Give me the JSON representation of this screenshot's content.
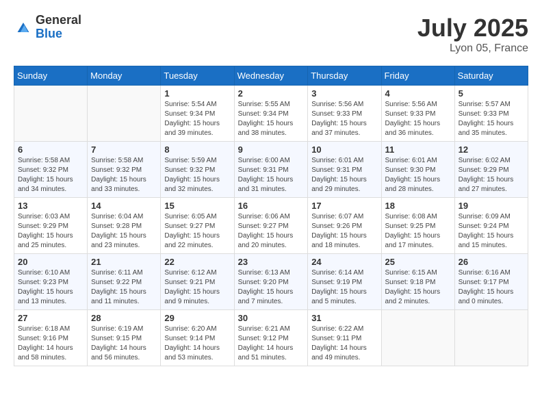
{
  "header": {
    "logo_general": "General",
    "logo_blue": "Blue",
    "month_year": "July 2025",
    "location": "Lyon 05, France"
  },
  "days_of_week": [
    "Sunday",
    "Monday",
    "Tuesday",
    "Wednesday",
    "Thursday",
    "Friday",
    "Saturday"
  ],
  "weeks": [
    [
      {
        "day": "",
        "info": ""
      },
      {
        "day": "",
        "info": ""
      },
      {
        "day": "1",
        "info": "Sunrise: 5:54 AM\nSunset: 9:34 PM\nDaylight: 15 hours and 39 minutes."
      },
      {
        "day": "2",
        "info": "Sunrise: 5:55 AM\nSunset: 9:34 PM\nDaylight: 15 hours and 38 minutes."
      },
      {
        "day": "3",
        "info": "Sunrise: 5:56 AM\nSunset: 9:33 PM\nDaylight: 15 hours and 37 minutes."
      },
      {
        "day": "4",
        "info": "Sunrise: 5:56 AM\nSunset: 9:33 PM\nDaylight: 15 hours and 36 minutes."
      },
      {
        "day": "5",
        "info": "Sunrise: 5:57 AM\nSunset: 9:33 PM\nDaylight: 15 hours and 35 minutes."
      }
    ],
    [
      {
        "day": "6",
        "info": "Sunrise: 5:58 AM\nSunset: 9:32 PM\nDaylight: 15 hours and 34 minutes."
      },
      {
        "day": "7",
        "info": "Sunrise: 5:58 AM\nSunset: 9:32 PM\nDaylight: 15 hours and 33 minutes."
      },
      {
        "day": "8",
        "info": "Sunrise: 5:59 AM\nSunset: 9:32 PM\nDaylight: 15 hours and 32 minutes."
      },
      {
        "day": "9",
        "info": "Sunrise: 6:00 AM\nSunset: 9:31 PM\nDaylight: 15 hours and 31 minutes."
      },
      {
        "day": "10",
        "info": "Sunrise: 6:01 AM\nSunset: 9:31 PM\nDaylight: 15 hours and 29 minutes."
      },
      {
        "day": "11",
        "info": "Sunrise: 6:01 AM\nSunset: 9:30 PM\nDaylight: 15 hours and 28 minutes."
      },
      {
        "day": "12",
        "info": "Sunrise: 6:02 AM\nSunset: 9:29 PM\nDaylight: 15 hours and 27 minutes."
      }
    ],
    [
      {
        "day": "13",
        "info": "Sunrise: 6:03 AM\nSunset: 9:29 PM\nDaylight: 15 hours and 25 minutes."
      },
      {
        "day": "14",
        "info": "Sunrise: 6:04 AM\nSunset: 9:28 PM\nDaylight: 15 hours and 23 minutes."
      },
      {
        "day": "15",
        "info": "Sunrise: 6:05 AM\nSunset: 9:27 PM\nDaylight: 15 hours and 22 minutes."
      },
      {
        "day": "16",
        "info": "Sunrise: 6:06 AM\nSunset: 9:27 PM\nDaylight: 15 hours and 20 minutes."
      },
      {
        "day": "17",
        "info": "Sunrise: 6:07 AM\nSunset: 9:26 PM\nDaylight: 15 hours and 18 minutes."
      },
      {
        "day": "18",
        "info": "Sunrise: 6:08 AM\nSunset: 9:25 PM\nDaylight: 15 hours and 17 minutes."
      },
      {
        "day": "19",
        "info": "Sunrise: 6:09 AM\nSunset: 9:24 PM\nDaylight: 15 hours and 15 minutes."
      }
    ],
    [
      {
        "day": "20",
        "info": "Sunrise: 6:10 AM\nSunset: 9:23 PM\nDaylight: 15 hours and 13 minutes."
      },
      {
        "day": "21",
        "info": "Sunrise: 6:11 AM\nSunset: 9:22 PM\nDaylight: 15 hours and 11 minutes."
      },
      {
        "day": "22",
        "info": "Sunrise: 6:12 AM\nSunset: 9:21 PM\nDaylight: 15 hours and 9 minutes."
      },
      {
        "day": "23",
        "info": "Sunrise: 6:13 AM\nSunset: 9:20 PM\nDaylight: 15 hours and 7 minutes."
      },
      {
        "day": "24",
        "info": "Sunrise: 6:14 AM\nSunset: 9:19 PM\nDaylight: 15 hours and 5 minutes."
      },
      {
        "day": "25",
        "info": "Sunrise: 6:15 AM\nSunset: 9:18 PM\nDaylight: 15 hours and 2 minutes."
      },
      {
        "day": "26",
        "info": "Sunrise: 6:16 AM\nSunset: 9:17 PM\nDaylight: 15 hours and 0 minutes."
      }
    ],
    [
      {
        "day": "27",
        "info": "Sunrise: 6:18 AM\nSunset: 9:16 PM\nDaylight: 14 hours and 58 minutes."
      },
      {
        "day": "28",
        "info": "Sunrise: 6:19 AM\nSunset: 9:15 PM\nDaylight: 14 hours and 56 minutes."
      },
      {
        "day": "29",
        "info": "Sunrise: 6:20 AM\nSunset: 9:14 PM\nDaylight: 14 hours and 53 minutes."
      },
      {
        "day": "30",
        "info": "Sunrise: 6:21 AM\nSunset: 9:12 PM\nDaylight: 14 hours and 51 minutes."
      },
      {
        "day": "31",
        "info": "Sunrise: 6:22 AM\nSunset: 9:11 PM\nDaylight: 14 hours and 49 minutes."
      },
      {
        "day": "",
        "info": ""
      },
      {
        "day": "",
        "info": ""
      }
    ]
  ]
}
